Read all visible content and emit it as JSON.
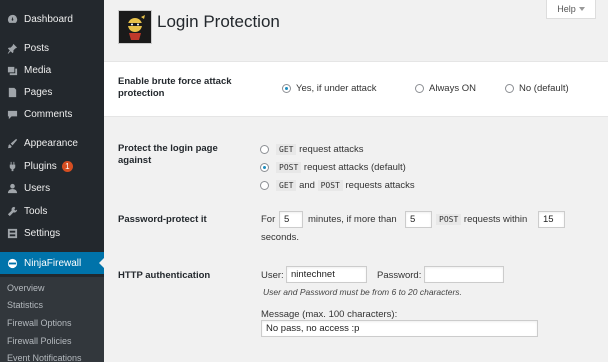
{
  "sidebar": {
    "items": [
      {
        "label": "Dashboard",
        "icon": "dashboard-icon"
      },
      {
        "label": "Posts",
        "icon": "pin-icon"
      },
      {
        "label": "Media",
        "icon": "media-icon"
      },
      {
        "label": "Pages",
        "icon": "pages-icon"
      },
      {
        "label": "Comments",
        "icon": "comment-icon"
      },
      {
        "label": "Appearance",
        "icon": "brush-icon"
      },
      {
        "label": "Plugins",
        "icon": "plug-icon",
        "badge": "1"
      },
      {
        "label": "Users",
        "icon": "user-icon"
      },
      {
        "label": "Tools",
        "icon": "wrench-icon"
      },
      {
        "label": "Settings",
        "icon": "settings-icon"
      },
      {
        "label": "NinjaFirewall",
        "icon": "ninja-icon"
      }
    ],
    "submenu": [
      "Overview",
      "Statistics",
      "Firewall Options",
      "Firewall Policies",
      "Event Notifications"
    ]
  },
  "header": {
    "title": "Login Protection",
    "help_label": "Help"
  },
  "brute_force": {
    "label": "Enable brute force attack protection",
    "options": [
      "Yes, if under attack",
      "Always ON",
      "No (default)"
    ],
    "selected": "Yes, if under attack"
  },
  "protect_login": {
    "label": "Protect the login page against",
    "get_code": "GET",
    "get_text": "request attacks",
    "post_code": "POST",
    "post_text": "request attacks (default)",
    "both_get_code": "GET",
    "both_and": "and",
    "both_post_code": "POST",
    "both_text": "requests attacks",
    "selected": "POST request attacks (default)"
  },
  "password_protect": {
    "label": "Password-protect it",
    "for_text": "For",
    "minutes_value": "5",
    "minutes_text": "minutes, if more than",
    "count_value": "5",
    "post_code": "POST",
    "within_text": "requests within",
    "seconds_value": "15",
    "seconds_text": "seconds."
  },
  "http_auth": {
    "label": "HTTP authentication",
    "user_label": "User:",
    "user_value": "nintechnet",
    "password_label": "Password:",
    "password_value": "",
    "note": "User and Password must be from 6 to 20 characters.",
    "message_label": "Message (max. 100 characters):",
    "message_value": "No pass, no access :p"
  },
  "colors": {
    "sidebar_bg": "#23282d",
    "active_bg": "#0073aa",
    "badge": "#d54e21"
  }
}
